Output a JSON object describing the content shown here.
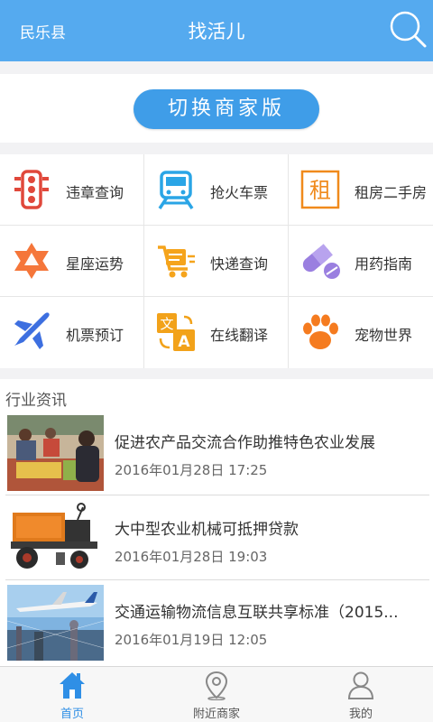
{
  "header": {
    "city": "民乐县",
    "title": "找活儿",
    "search_icon": "search-icon"
  },
  "switch_button": {
    "label": "切换商家版"
  },
  "services": [
    {
      "label": "违章查询",
      "icon": "traffic-light-icon",
      "color": "#e0483b"
    },
    {
      "label": "抢火车票",
      "icon": "train-icon",
      "color": "#2aa5e6"
    },
    {
      "label": "租房二手房",
      "icon": "rent-icon",
      "color": "#f08a1c"
    },
    {
      "label": "星座运势",
      "icon": "star-of-david-icon",
      "color": "#f5763a"
    },
    {
      "label": "快递查询",
      "icon": "delivery-cart-icon",
      "color": "#f5a41c"
    },
    {
      "label": "用药指南",
      "icon": "pill-icon",
      "color": "#9a7fe0"
    },
    {
      "label": "机票预订",
      "icon": "airplane-icon",
      "color": "#3d6fe0"
    },
    {
      "label": "在线翻译",
      "icon": "translate-icon",
      "color": "#f2a21a"
    },
    {
      "label": "宠物世界",
      "icon": "paw-icon",
      "color": "#f57b1f"
    }
  ],
  "rent_char": "租",
  "translate_chars": {
    "a": "文",
    "b": "A"
  },
  "news": {
    "section_title": "行业资讯",
    "items": [
      {
        "title": "促进农产品交流合作助推特色农业发展",
        "time": "2016年01月28日 17:25"
      },
      {
        "title": "大中型农业机械可抵押贷款",
        "time": "2016年01月28日 19:03"
      },
      {
        "title": "交通运输物流信息互联共享标准（2015...",
        "time": "2016年01月19日 12:05"
      }
    ]
  },
  "tabbar": {
    "tabs": [
      {
        "label": "首页",
        "icon": "home-icon",
        "active": true
      },
      {
        "label": "附近商家",
        "icon": "location-pin-icon",
        "active": false
      },
      {
        "label": "我的",
        "icon": "user-icon",
        "active": false
      }
    ],
    "active_color": "#2f8fe6"
  }
}
